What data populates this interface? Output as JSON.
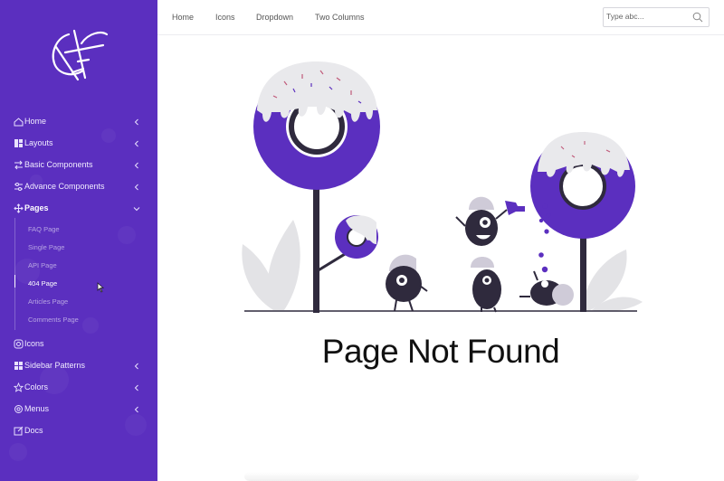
{
  "sidebar": {
    "items": [
      {
        "label": "Home",
        "icon": "home-icon",
        "chevron": "left"
      },
      {
        "label": "Layouts",
        "icon": "layouts-icon",
        "chevron": "left"
      },
      {
        "label": "Basic Components",
        "icon": "swap-icon",
        "chevron": "left"
      },
      {
        "label": "Advance Components",
        "icon": "sliders-icon",
        "chevron": "left"
      },
      {
        "label": "Pages",
        "icon": "move-icon",
        "chevron": "down"
      },
      {
        "label": "Icons",
        "icon": "instagram-icon",
        "chevron": ""
      },
      {
        "label": "Sidebar Patterns",
        "icon": "grid-icon",
        "chevron": "left"
      },
      {
        "label": "Colors",
        "icon": "star-icon",
        "chevron": "left"
      },
      {
        "label": "Menus",
        "icon": "settings-icon",
        "chevron": "left"
      },
      {
        "label": "Docs",
        "icon": "edit-icon",
        "chevron": ""
      }
    ],
    "pages_submenu": [
      {
        "label": "FAQ Page"
      },
      {
        "label": "Single Page"
      },
      {
        "label": "API Page"
      },
      {
        "label": "404 Page",
        "current": true
      },
      {
        "label": "Articles Page"
      },
      {
        "label": "Comments Page"
      }
    ]
  },
  "topbar": {
    "links": [
      "Home",
      "Icons",
      "Dropdown",
      "Two Columns"
    ],
    "search_placeholder": "Type abc..."
  },
  "main": {
    "title": "Page Not Found"
  },
  "colors": {
    "sidebar": "#5b2fbf",
    "accent": "#5b2fbf",
    "dark": "#2f2a3d",
    "icing": "#ececf0"
  }
}
